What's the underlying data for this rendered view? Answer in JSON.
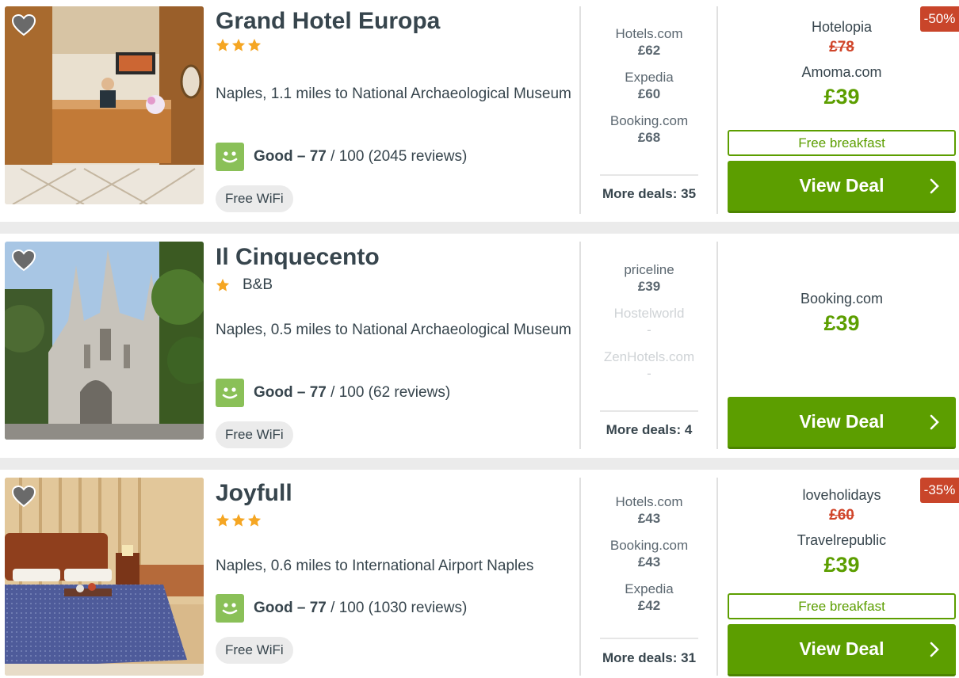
{
  "hotels": [
    {
      "name": "Grand Hotel Europa",
      "stars": 3,
      "type": "",
      "location": "Naples, 1.1 miles to National Archaeological Museum",
      "rating_label": "Good – 77",
      "rating_rest": " / 100 (2045 reviews)",
      "amenity": "Free WiFi",
      "providers": [
        {
          "name": "Hotels.com",
          "price": "£62"
        },
        {
          "name": "Expedia",
          "price": "£60"
        },
        {
          "name": "Booking.com",
          "price": "£68"
        }
      ],
      "more_deals": "More deals: 35",
      "badge": "-50%",
      "old_provider": "Hotelopia",
      "old_price": "£78",
      "best_provider": "Amoma.com",
      "best_price": "£39",
      "perk": "Free breakfast",
      "button": "View Deal"
    },
    {
      "name": "Il Cinquecento",
      "stars": 1,
      "type": "B&B",
      "location": "Naples, 0.5 miles to National Archaeological Museum",
      "rating_label": "Good – 77",
      "rating_rest": " / 100 (62 reviews)",
      "amenity": "Free WiFi",
      "providers": [
        {
          "name": "priceline",
          "price": "£39"
        },
        {
          "name": "Hostelworld",
          "price": "-"
        },
        {
          "name": "ZenHotels.com",
          "price": "-"
        }
      ],
      "more_deals": "More deals: 4",
      "best_provider": "Booking.com",
      "best_price": "£39",
      "button": "View Deal"
    },
    {
      "name": "Joyfull",
      "stars": 3,
      "type": "",
      "location": "Naples, 0.6 miles to International Airport Naples",
      "rating_label": "Good – 77",
      "rating_rest": " / 100 (1030 reviews)",
      "amenity": "Free WiFi",
      "providers": [
        {
          "name": "Hotels.com",
          "price": "£43"
        },
        {
          "name": "Booking.com",
          "price": "£43"
        },
        {
          "name": "Expedia",
          "price": "£42"
        }
      ],
      "more_deals": "More deals: 31",
      "badge": "-35%",
      "old_provider": "loveholidays",
      "old_price": "£60",
      "best_provider": "Travelrepublic",
      "best_price": "£39",
      "perk": "Free breakfast",
      "button": "View Deal"
    }
  ],
  "colors": {
    "accent_green": "#5c9e00",
    "rating_green": "#8ac058",
    "discount_red": "#c9452a",
    "star_orange": "#f5a623"
  },
  "icons": [
    "heart-icon",
    "star-icon",
    "smiley-icon",
    "chevron-right-icon"
  ]
}
